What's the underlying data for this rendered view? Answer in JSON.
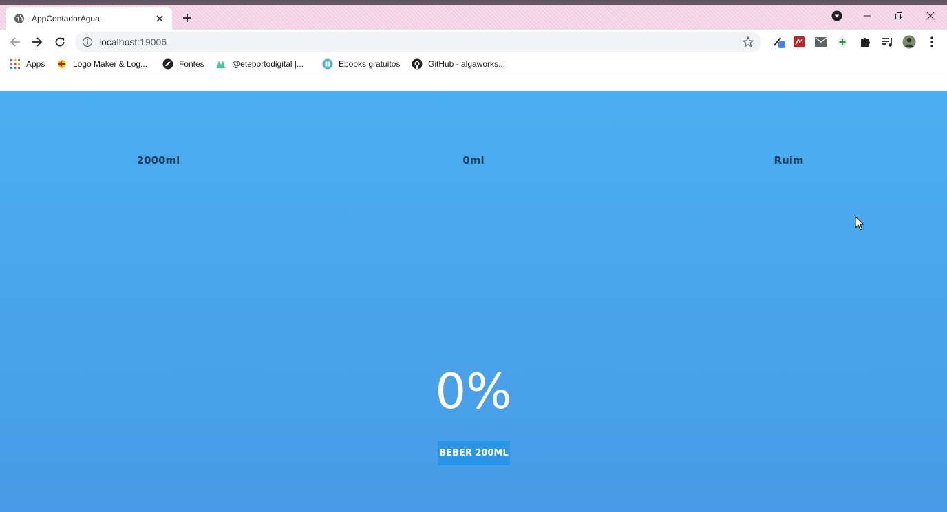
{
  "browser": {
    "tab": {
      "title": "AppContadorAgua"
    },
    "address": {
      "host": "localhost",
      "port": ":19006"
    },
    "bookmarks": [
      {
        "label": "Apps",
        "icon": "apps-grid-icon"
      },
      {
        "label": "Logo Maker & Log...",
        "icon": "logo-maker-icon"
      },
      {
        "label": "Fontes",
        "icon": "fontes-icon"
      },
      {
        "label": "@eteportodigital |...",
        "icon": "eteporto-icon"
      },
      {
        "label": "Ebooks gratuitos",
        "icon": "ebooks-icon"
      },
      {
        "label": "GitHub - algaworks...",
        "icon": "github-icon"
      }
    ]
  },
  "app": {
    "goal": "2000ml",
    "consumed": "0ml",
    "status": "Ruim",
    "percent": "0%",
    "drink_button": "BEBER 200ML",
    "colors": {
      "bg_top": "#4aaff0",
      "bg_bottom": "#489be6",
      "button": "#2a96e8",
      "stat_text": "#1f3e5c"
    }
  }
}
